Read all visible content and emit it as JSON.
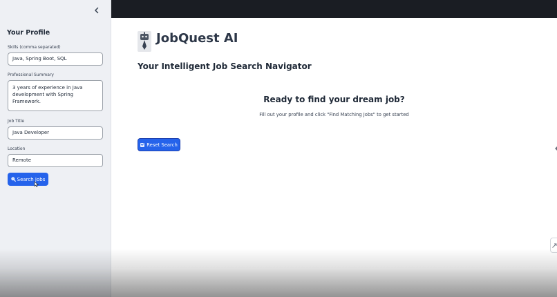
{
  "sidebar": {
    "title": "Your Profile",
    "skills": {
      "label": "Skills (comma separated)",
      "value": "Java, Spring Boot, SQL"
    },
    "summary": {
      "label": "Professional Summary",
      "value": "3 years of experience in Java development with Spring Framework."
    },
    "job_title": {
      "label": "Job Title",
      "value": "Java Developer"
    },
    "location": {
      "label": "Location",
      "value": "Remote"
    },
    "search_button": "Search Jobs"
  },
  "main": {
    "app_title": "JobQuest AI",
    "subtitle": "Your Intelligent Job Search Navigator",
    "ready_title": "Ready to find your dream job?",
    "ready_text": "Fill out your profile and click \"Find Matching Jobs\" to get started",
    "reset_button": "Reset Search"
  },
  "colors": {
    "accent": "#2563eb",
    "sidebar_bg": "#eef0f4",
    "topbar_bg": "#1a1d23"
  },
  "icons": [
    "chevron-left-icon",
    "magnifier-icon",
    "checkbox-icon",
    "robot-logo-icon",
    "expand-icon"
  ]
}
